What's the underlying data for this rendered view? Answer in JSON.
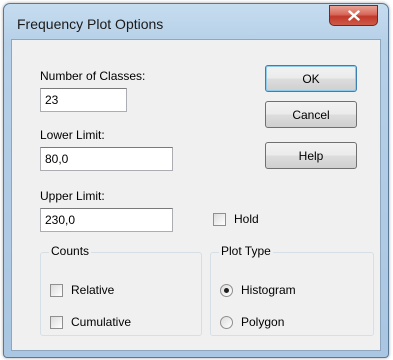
{
  "window": {
    "title": "Frequency Plot Options",
    "close_icon": "close-icon"
  },
  "fields": {
    "num_classes_label": "Number of Classes:",
    "num_classes_value": "23",
    "lower_limit_label": "Lower Limit:",
    "lower_limit_value": "80,0",
    "upper_limit_label": "Upper Limit:",
    "upper_limit_value": "230,0"
  },
  "buttons": {
    "ok": "OK",
    "cancel": "Cancel",
    "help": "Help"
  },
  "hold": {
    "label": "Hold",
    "checked": false
  },
  "counts": {
    "legend": "Counts",
    "relative": {
      "label": "Relative",
      "checked": false
    },
    "cumulative": {
      "label": "Cumulative",
      "checked": false
    }
  },
  "plot_type": {
    "legend": "Plot Type",
    "histogram": {
      "label": "Histogram",
      "selected": true
    },
    "polygon": {
      "label": "Polygon",
      "selected": false
    }
  }
}
